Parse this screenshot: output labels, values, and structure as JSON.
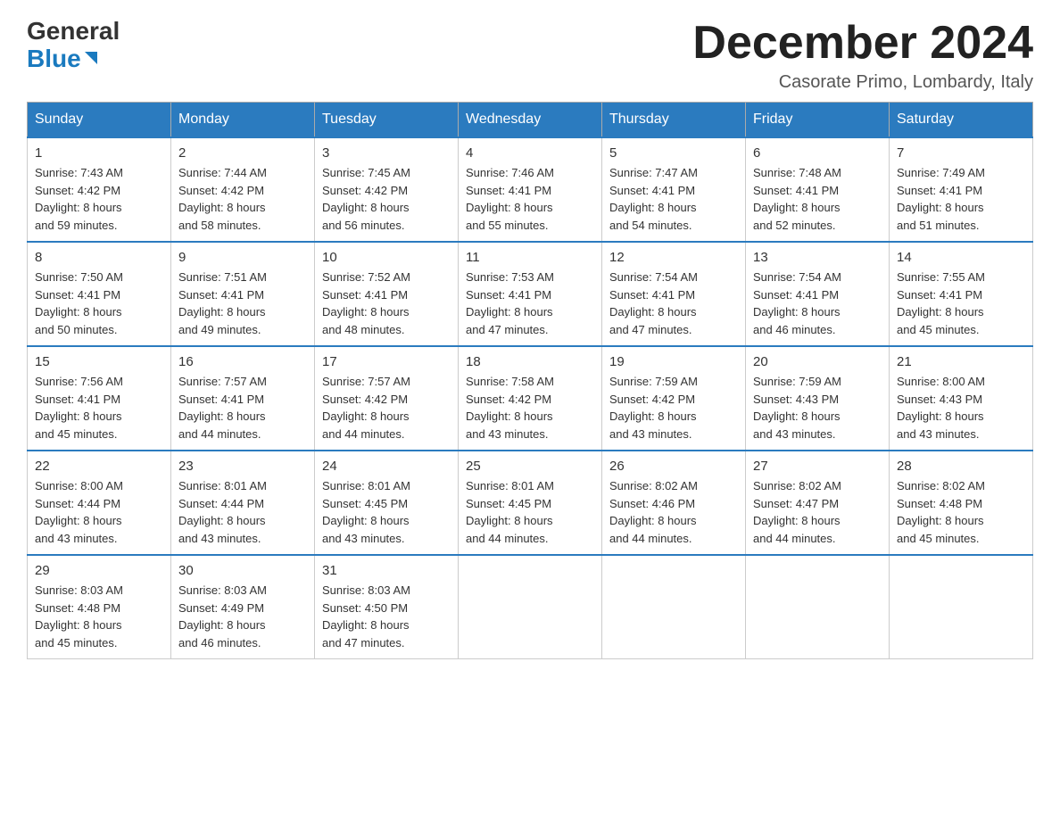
{
  "logo": {
    "general": "General",
    "blue": "Blue"
  },
  "header": {
    "month_year": "December 2024",
    "location": "Casorate Primo, Lombardy, Italy"
  },
  "days_of_week": [
    "Sunday",
    "Monday",
    "Tuesday",
    "Wednesday",
    "Thursday",
    "Friday",
    "Saturday"
  ],
  "weeks": [
    [
      {
        "day": "1",
        "sunrise": "Sunrise: 7:43 AM",
        "sunset": "Sunset: 4:42 PM",
        "daylight": "Daylight: 8 hours",
        "daylight2": "and 59 minutes."
      },
      {
        "day": "2",
        "sunrise": "Sunrise: 7:44 AM",
        "sunset": "Sunset: 4:42 PM",
        "daylight": "Daylight: 8 hours",
        "daylight2": "and 58 minutes."
      },
      {
        "day": "3",
        "sunrise": "Sunrise: 7:45 AM",
        "sunset": "Sunset: 4:42 PM",
        "daylight": "Daylight: 8 hours",
        "daylight2": "and 56 minutes."
      },
      {
        "day": "4",
        "sunrise": "Sunrise: 7:46 AM",
        "sunset": "Sunset: 4:41 PM",
        "daylight": "Daylight: 8 hours",
        "daylight2": "and 55 minutes."
      },
      {
        "day": "5",
        "sunrise": "Sunrise: 7:47 AM",
        "sunset": "Sunset: 4:41 PM",
        "daylight": "Daylight: 8 hours",
        "daylight2": "and 54 minutes."
      },
      {
        "day": "6",
        "sunrise": "Sunrise: 7:48 AM",
        "sunset": "Sunset: 4:41 PM",
        "daylight": "Daylight: 8 hours",
        "daylight2": "and 52 minutes."
      },
      {
        "day": "7",
        "sunrise": "Sunrise: 7:49 AM",
        "sunset": "Sunset: 4:41 PM",
        "daylight": "Daylight: 8 hours",
        "daylight2": "and 51 minutes."
      }
    ],
    [
      {
        "day": "8",
        "sunrise": "Sunrise: 7:50 AM",
        "sunset": "Sunset: 4:41 PM",
        "daylight": "Daylight: 8 hours",
        "daylight2": "and 50 minutes."
      },
      {
        "day": "9",
        "sunrise": "Sunrise: 7:51 AM",
        "sunset": "Sunset: 4:41 PM",
        "daylight": "Daylight: 8 hours",
        "daylight2": "and 49 minutes."
      },
      {
        "day": "10",
        "sunrise": "Sunrise: 7:52 AM",
        "sunset": "Sunset: 4:41 PM",
        "daylight": "Daylight: 8 hours",
        "daylight2": "and 48 minutes."
      },
      {
        "day": "11",
        "sunrise": "Sunrise: 7:53 AM",
        "sunset": "Sunset: 4:41 PM",
        "daylight": "Daylight: 8 hours",
        "daylight2": "and 47 minutes."
      },
      {
        "day": "12",
        "sunrise": "Sunrise: 7:54 AM",
        "sunset": "Sunset: 4:41 PM",
        "daylight": "Daylight: 8 hours",
        "daylight2": "and 47 minutes."
      },
      {
        "day": "13",
        "sunrise": "Sunrise: 7:54 AM",
        "sunset": "Sunset: 4:41 PM",
        "daylight": "Daylight: 8 hours",
        "daylight2": "and 46 minutes."
      },
      {
        "day": "14",
        "sunrise": "Sunrise: 7:55 AM",
        "sunset": "Sunset: 4:41 PM",
        "daylight": "Daylight: 8 hours",
        "daylight2": "and 45 minutes."
      }
    ],
    [
      {
        "day": "15",
        "sunrise": "Sunrise: 7:56 AM",
        "sunset": "Sunset: 4:41 PM",
        "daylight": "Daylight: 8 hours",
        "daylight2": "and 45 minutes."
      },
      {
        "day": "16",
        "sunrise": "Sunrise: 7:57 AM",
        "sunset": "Sunset: 4:41 PM",
        "daylight": "Daylight: 8 hours",
        "daylight2": "and 44 minutes."
      },
      {
        "day": "17",
        "sunrise": "Sunrise: 7:57 AM",
        "sunset": "Sunset: 4:42 PM",
        "daylight": "Daylight: 8 hours",
        "daylight2": "and 44 minutes."
      },
      {
        "day": "18",
        "sunrise": "Sunrise: 7:58 AM",
        "sunset": "Sunset: 4:42 PM",
        "daylight": "Daylight: 8 hours",
        "daylight2": "and 43 minutes."
      },
      {
        "day": "19",
        "sunrise": "Sunrise: 7:59 AM",
        "sunset": "Sunset: 4:42 PM",
        "daylight": "Daylight: 8 hours",
        "daylight2": "and 43 minutes."
      },
      {
        "day": "20",
        "sunrise": "Sunrise: 7:59 AM",
        "sunset": "Sunset: 4:43 PM",
        "daylight": "Daylight: 8 hours",
        "daylight2": "and 43 minutes."
      },
      {
        "day": "21",
        "sunrise": "Sunrise: 8:00 AM",
        "sunset": "Sunset: 4:43 PM",
        "daylight": "Daylight: 8 hours",
        "daylight2": "and 43 minutes."
      }
    ],
    [
      {
        "day": "22",
        "sunrise": "Sunrise: 8:00 AM",
        "sunset": "Sunset: 4:44 PM",
        "daylight": "Daylight: 8 hours",
        "daylight2": "and 43 minutes."
      },
      {
        "day": "23",
        "sunrise": "Sunrise: 8:01 AM",
        "sunset": "Sunset: 4:44 PM",
        "daylight": "Daylight: 8 hours",
        "daylight2": "and 43 minutes."
      },
      {
        "day": "24",
        "sunrise": "Sunrise: 8:01 AM",
        "sunset": "Sunset: 4:45 PM",
        "daylight": "Daylight: 8 hours",
        "daylight2": "and 43 minutes."
      },
      {
        "day": "25",
        "sunrise": "Sunrise: 8:01 AM",
        "sunset": "Sunset: 4:45 PM",
        "daylight": "Daylight: 8 hours",
        "daylight2": "and 44 minutes."
      },
      {
        "day": "26",
        "sunrise": "Sunrise: 8:02 AM",
        "sunset": "Sunset: 4:46 PM",
        "daylight": "Daylight: 8 hours",
        "daylight2": "and 44 minutes."
      },
      {
        "day": "27",
        "sunrise": "Sunrise: 8:02 AM",
        "sunset": "Sunset: 4:47 PM",
        "daylight": "Daylight: 8 hours",
        "daylight2": "and 44 minutes."
      },
      {
        "day": "28",
        "sunrise": "Sunrise: 8:02 AM",
        "sunset": "Sunset: 4:48 PM",
        "daylight": "Daylight: 8 hours",
        "daylight2": "and 45 minutes."
      }
    ],
    [
      {
        "day": "29",
        "sunrise": "Sunrise: 8:03 AM",
        "sunset": "Sunset: 4:48 PM",
        "daylight": "Daylight: 8 hours",
        "daylight2": "and 45 minutes."
      },
      {
        "day": "30",
        "sunrise": "Sunrise: 8:03 AM",
        "sunset": "Sunset: 4:49 PM",
        "daylight": "Daylight: 8 hours",
        "daylight2": "and 46 minutes."
      },
      {
        "day": "31",
        "sunrise": "Sunrise: 8:03 AM",
        "sunset": "Sunset: 4:50 PM",
        "daylight": "Daylight: 8 hours",
        "daylight2": "and 47 minutes."
      },
      null,
      null,
      null,
      null
    ]
  ]
}
